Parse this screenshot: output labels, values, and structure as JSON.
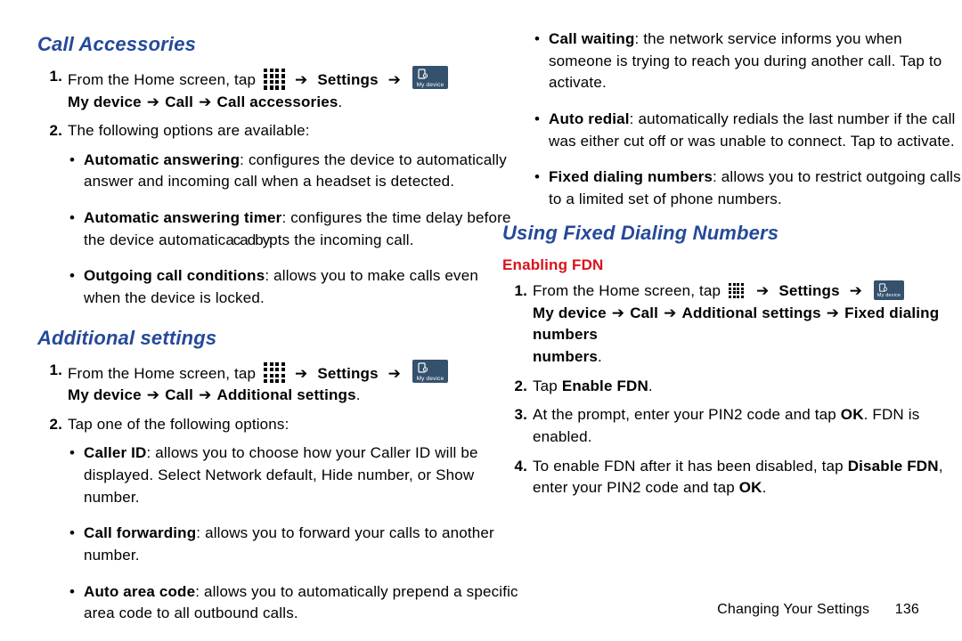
{
  "headings": {
    "call_accessories": "Call Accessories",
    "additional_settings": "Additional settings",
    "using_fdn": "Using Fixed Dialing Numbers",
    "enabling_fdn": "Enabling FDN"
  },
  "icons": {
    "apps": "apps-grid-icon",
    "mydevice_label": "My device"
  },
  "nav": {
    "settings": "Settings",
    "my_device": "My device",
    "call": "Call",
    "call_accessories": "Call accessories",
    "additional_settings": "Additional settings",
    "fixed_dialing_numbers": "Fixed dialing numbers",
    "from_home_tap": "From the Home screen, tap"
  },
  "text": {
    "following_options": "The following options are available:",
    "auto_answer_label": "Automatic answering",
    "auto_answer_desc": ": configures the device to automatically answer and incoming call when a headset is detected.",
    "auto_timer_label": "Automatic answering timer",
    "auto_timer_desc_a": ": configures the time delay before the device automatic",
    "auto_timer_desc_overlay": "acadby",
    "auto_timer_desc_b": "pts the incoming call.",
    "outgoing_label": "Outgoing call conditions",
    "outgoing_desc": ": allows you to make calls even when the device is locked.",
    "tap_one": "Tap one of the following options:",
    "callerid_label": "Caller ID",
    "callerid_desc": ": allows you to choose how your Caller ID will be displayed. Select Network default, Hide number, or Show number.",
    "cfw_label": "Call forwarding",
    "cfw_desc": ": allows you to forward your calls to another number.",
    "aac_label": "Auto area code",
    "aac_desc": ": allows you to automatically prepend a specific area code to all outbound calls.",
    "cw_label": "Call waiting",
    "cw_desc": ": the network service informs you when someone is trying to reach you during another call. Tap to activate.",
    "ar_label": "Auto redial",
    "ar_desc": ": automatically redials the last number if the call was either cut off or was unable to connect. Tap to activate.",
    "fdn_label": "Fixed dialing numbers",
    "fdn_desc": ": allows you to restrict outgoing calls to a limited set of phone numbers.",
    "tap": "Tap ",
    "enable_fdn": "Enable FDN",
    "period": ".",
    "prompt_a": "At the prompt, enter your PIN2 code and tap ",
    "ok": "OK",
    "prompt_b": ". FDN is enabled.",
    "reenable_a": "To enable FDN after it has been disabled, tap ",
    "disable_fdn": "Disable FDN",
    "reenable_b": ", enter your PIN2 code and tap ",
    "numbers_label": "numbers"
  },
  "footer": {
    "chapter": "Changing Your Settings",
    "page": "136"
  }
}
